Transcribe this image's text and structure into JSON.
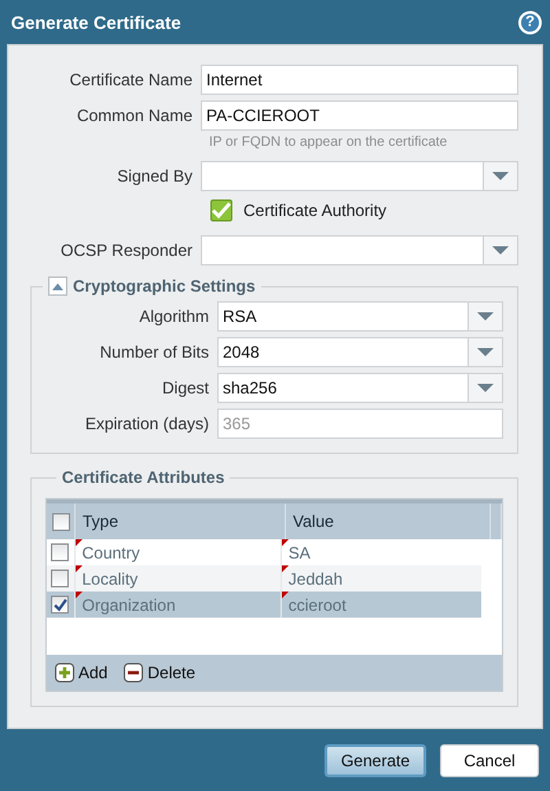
{
  "window": {
    "title": "Generate Certificate",
    "help": "?"
  },
  "fields": [
    {
      "kind": "text",
      "label": "Certificate Name",
      "value": "Internet"
    },
    {
      "kind": "text",
      "label": "Common Name",
      "value": "PA-CCIEROOT",
      "hint": "IP or FQDN to appear on the certificate"
    },
    {
      "kind": "select",
      "label": "Signed By"
    },
    {
      "kind": "checkbox",
      "label": "Certificate Authority",
      "checked": true
    },
    {
      "kind": "select",
      "label": "OCSP Responder"
    }
  ],
  "crypto": {
    "title": "Cryptographic Settings",
    "expanded": true,
    "fields": [
      {
        "kind": "select",
        "label": "Algorithm",
        "value": "RSA"
      },
      {
        "kind": "select",
        "label": "Number of Bits",
        "value": "2048"
      },
      {
        "kind": "select",
        "label": "Digest",
        "value": "sha256"
      },
      {
        "kind": "text",
        "label": "Expiration (days)",
        "placeholder": "365"
      }
    ]
  },
  "attributes": {
    "title": "Certificate Attributes",
    "all_checked": false,
    "columns": [
      "Type",
      "Value"
    ],
    "rows": [
      {
        "type": "Country",
        "value": "SA",
        "checked": false,
        "selected": false,
        "modified": true
      },
      {
        "type": "Locality",
        "value": "Jeddah",
        "checked": false,
        "selected": false,
        "modified": true
      },
      {
        "type": "Organization",
        "value": "ccieroot",
        "checked": true,
        "selected": true,
        "modified": true
      }
    ],
    "actions": [
      {
        "kind": "add",
        "label": "Add"
      },
      {
        "kind": "delete",
        "label": "Delete"
      }
    ]
  },
  "buttons": [
    {
      "label": "Generate",
      "primary": true
    },
    {
      "label": "Cancel",
      "primary": false
    }
  ]
}
